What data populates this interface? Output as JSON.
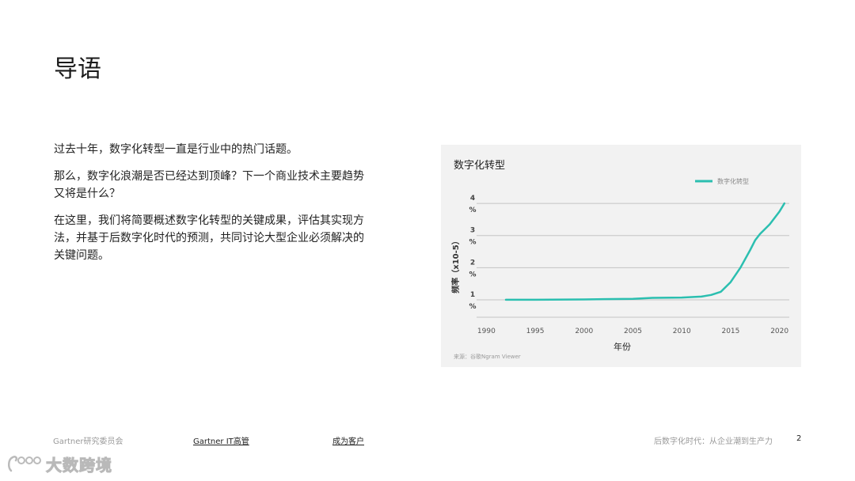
{
  "page": {
    "title": "导语",
    "paragraphs": [
      "过去十年，数字化转型一直是行业中的热门话题。",
      "那么，数字化浪潮是否已经达到顶峰？下一个商业技术主要趋势又将是什么？",
      "在这里，我们将简要概述数字化转型的关键成果，评估其实现方法，并基于后数字化时代的预测，共同讨论大型企业必须解决的关键问题。"
    ]
  },
  "chart_data": {
    "type": "line",
    "title": "数字化转型",
    "xlabel": "年份",
    "ylabel": "频率（x10-5）",
    "source": "来源：谷歌Ngram Viewer",
    "x_ticks": [
      "1990",
      "1995",
      "2000",
      "2005",
      "2010",
      "2015",
      "2020"
    ],
    "y_ticks": [
      {
        "value": 1,
        "label": "1",
        "unit": "%"
      },
      {
        "value": 2,
        "label": "2",
        "unit": "%"
      },
      {
        "value": 3,
        "label": "3",
        "unit": "%"
      },
      {
        "value": 4,
        "label": "4",
        "unit": "%"
      }
    ],
    "xlim": [
      1989,
      2021
    ],
    "ylim": [
      0.9,
      4.1
    ],
    "grid": true,
    "legend_position": "top-right",
    "color": "#2bbfb0",
    "series": [
      {
        "name": "数字化转型",
        "x": [
          1992,
          1995,
          2000,
          2005,
          2007,
          2010,
          2012,
          2013,
          2014,
          2015,
          2016,
          2017,
          2017.5,
          2018,
          2019,
          2020,
          2020.5
        ],
        "y": [
          1.0,
          1.0,
          1.01,
          1.03,
          1.06,
          1.07,
          1.1,
          1.15,
          1.25,
          1.55,
          2.0,
          2.55,
          2.85,
          3.05,
          3.35,
          3.75,
          4.0
        ]
      }
    ]
  },
  "footer": {
    "left": "Gartner研究委员会",
    "link1": "Gartner IT高管",
    "link2": "成为客户",
    "right": "后数字化时代：从企业潮到生产力",
    "page_number": "2"
  },
  "watermark": {
    "text": "大数跨境"
  }
}
